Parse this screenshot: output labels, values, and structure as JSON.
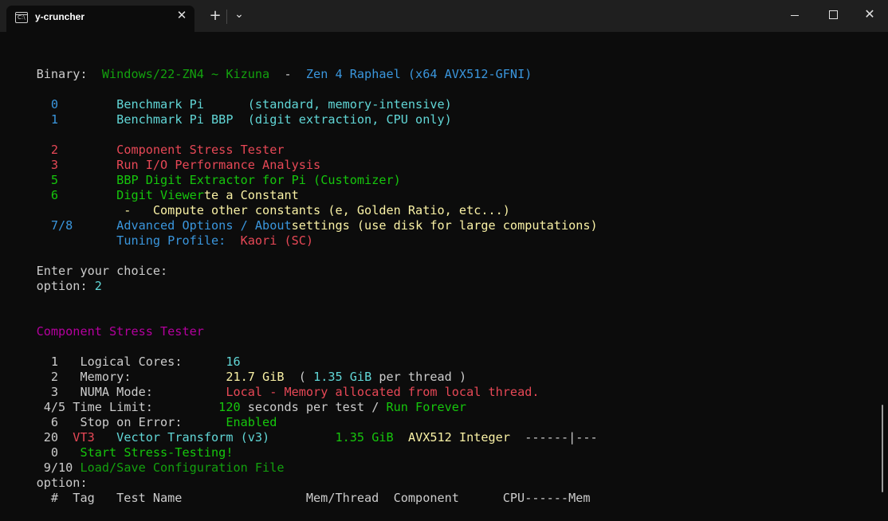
{
  "window": {
    "tab_title": "y-cruncher",
    "tab_icon": "terminal-icon",
    "tab_icon_glyph": "C:\\",
    "new_tab_symbol": "+",
    "dropdown_symbol": "⌄",
    "close_tab_symbol": "✕",
    "close_window_symbol": "✕"
  },
  "colors": {
    "background": "#0c0c0c",
    "titlebar": "#1f1f1f",
    "green": "#13a10e",
    "bright_green": "#16c60c",
    "cyan": "#61d6d6",
    "blue": "#3b78ff",
    "red": "#e74856",
    "yellow": "#f9f1a5",
    "magenta": "#b4009e"
  },
  "terminal": {
    "binary_label": "Binary:  ",
    "binary_name": "Windows/22-ZN4 ~ Kizuna",
    "binary_sep": "  -  ",
    "binary_target": "Zen 4 Raphael (x64 AVX512-GFNI)",
    "m0_num": "  0",
    "m0_pad": "        ",
    "m0_name": "Benchmark Pi      (standard, memory-intensive)",
    "m1_num": "  1",
    "m1_pad": "        ",
    "m1_name": "Benchmark Pi BBP  (digit extraction, CPU only)",
    "m2_num": "  2",
    "m2_pad": "        ",
    "m2_name": "Component Stress Tester",
    "m3_num": "  3",
    "m3_pad": "        ",
    "m3_name": "Run I/O Performance Analysis",
    "m5_num": "  5",
    "m5_pad": "        ",
    "m5_name": "BBP Digit Extractor for Pi (Customizer)",
    "m6_num": "  6",
    "m6_pad": "        ",
    "m6_name": "Digit Viewer",
    "m6_tail": "te a Constant",
    "compute_pad": "            -   ",
    "compute_text": "Compute other constants (e, Golden Ratio, etc...)",
    "m78_num": "  7/8",
    "m78_pad": "      ",
    "m78_name": "Advanced Options / About",
    "m78_tail": "settings (use disk for large computations)",
    "tuning_pad": "           ",
    "tuning_label": "Tuning Profile:  ",
    "tuning_value": "Kaori (SC)",
    "enter_choice": "Enter your choice:",
    "option_label": "option: ",
    "option_value": "2",
    "section_title": "Component Stress Tester",
    "r1_num": "  1   ",
    "r1_label": "Logical Cores:      ",
    "r1_value": "16",
    "r2_num": "  2   ",
    "r2_label": "Memory:             ",
    "r2_value": "21.7 GiB",
    "r2_paren_open": "  ( ",
    "r2_per": "1.35 GiB",
    "r2_per_text": " per thread )",
    "r3_num": "  3   ",
    "r3_label": "NUMA Mode:          ",
    "r3_value": "Local - Memory allocated from local thread.",
    "r45_num": " 4/5 ",
    "r45_label": "Time Limit:         ",
    "r45_value": "120",
    "r45_text": " seconds per test / ",
    "r45_forever": "Run Forever",
    "r6_num": "  6   ",
    "r6_label": "Stop on Error:      ",
    "r6_value": "Enabled",
    "r20_num": " 20  ",
    "r20_tag": "VT3",
    "r20_gap": "   ",
    "r20_name": "Vector Transform (v3)",
    "r20_gap2": "         ",
    "r20_mem": "1.35 GiB",
    "r20_gap3": "  ",
    "r20_comp": "AVX512 Integer",
    "r20_bar": "  ------|---",
    "r0_num": "  0   ",
    "r0_label": "Start Stress-Testing!",
    "r910_num": " 9/10 ",
    "r910_label": "Load/Save Configuration File",
    "option2": "option:",
    "header": "  #  Tag   Test Name                 Mem/Thread  Component      CPU------Mem"
  }
}
